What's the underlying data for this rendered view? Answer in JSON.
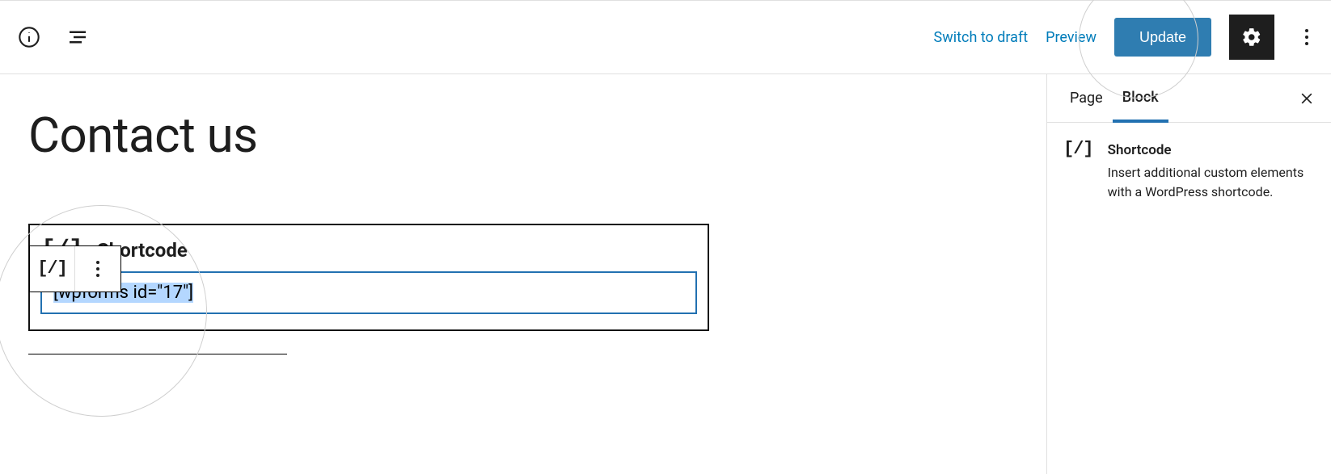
{
  "topbar": {
    "switch_draft": "Switch to draft",
    "preview": "Preview",
    "update": "Update"
  },
  "editor": {
    "page_title": "Contact us",
    "shortcode_label": "Shortcode",
    "shortcode_value": "[wpforms id=\"17\"]"
  },
  "sidebar": {
    "tabs": {
      "page": "Page",
      "block": "Block"
    },
    "block": {
      "title": "Shortcode",
      "desc": "Insert additional custom elements with a WordPress shortcode."
    }
  }
}
